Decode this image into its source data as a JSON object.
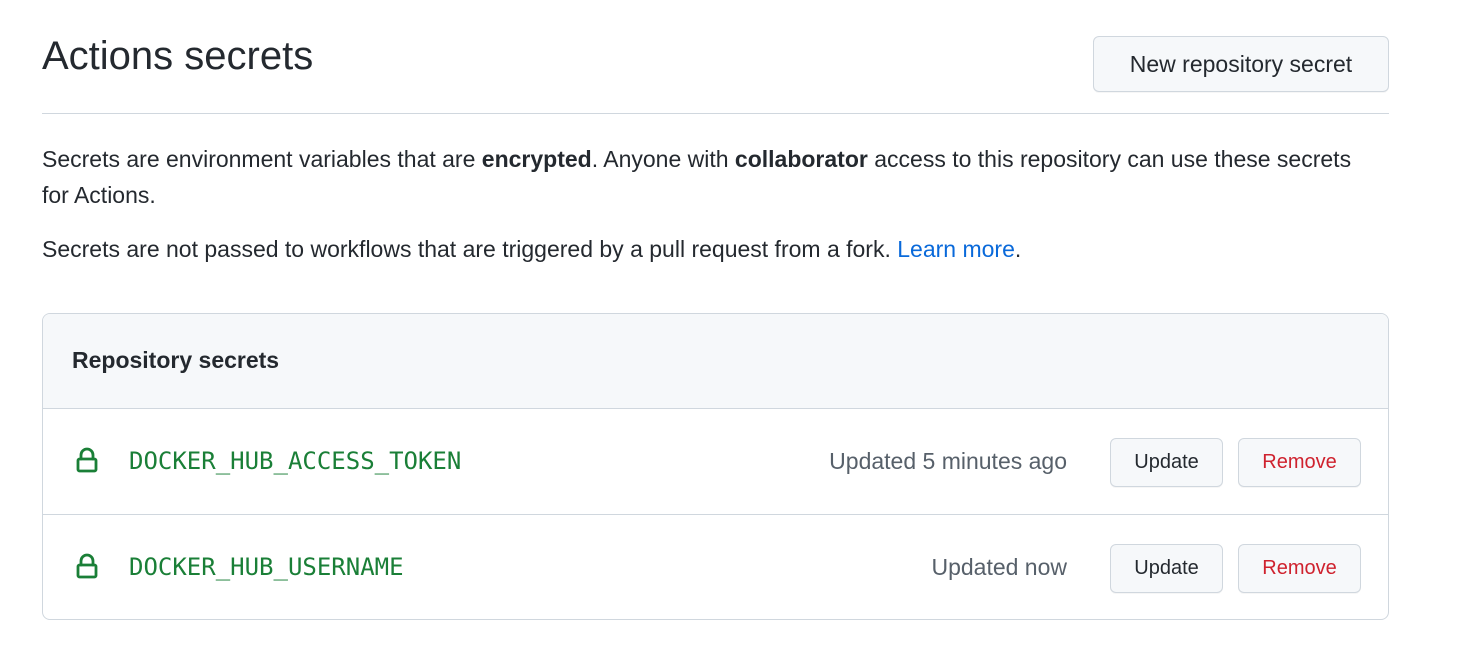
{
  "page": {
    "title": "Actions secrets",
    "new_secret_button": "New repository secret"
  },
  "description": {
    "line1_part1": "Secrets are environment variables that are ",
    "line1_bold1": "encrypted",
    "line1_part2": ". Anyone with ",
    "line1_bold2": "collaborator",
    "line1_part3": " access to this repository can use these secrets for Actions.",
    "line2_text": "Secrets are not passed to workflows that are triggered by a pull request from a fork. ",
    "line2_link": "Learn more",
    "line2_end": "."
  },
  "secrets_box": {
    "title": "Repository secrets",
    "items": [
      {
        "name": "DOCKER_HUB_ACCESS_TOKEN",
        "updated": "Updated 5 minutes ago",
        "update_label": "Update",
        "remove_label": "Remove",
        "icon": "lock-icon"
      },
      {
        "name": "DOCKER_HUB_USERNAME",
        "updated": "Updated now",
        "update_label": "Update",
        "remove_label": "Remove",
        "icon": "lock-icon"
      }
    ]
  },
  "colors": {
    "secret_name": "#1a7f37",
    "link": "#0969da",
    "danger": "#cf222e",
    "muted": "#57606a"
  }
}
